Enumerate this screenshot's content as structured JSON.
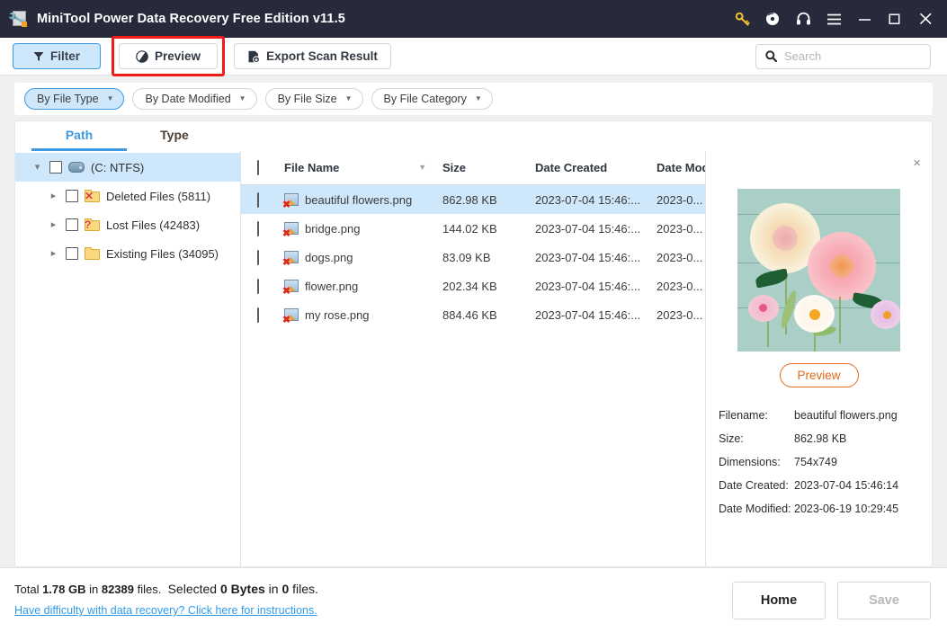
{
  "titlebar": {
    "app_icon": "wrench-document-icon",
    "title": "MiniTool Power Data Recovery Free Edition v11.5",
    "actions": [
      {
        "name": "key-icon",
        "glyph": "key",
        "color": "#f2c230"
      },
      {
        "name": "disc-icon",
        "glyph": "disc",
        "color": "#ffffff"
      },
      {
        "name": "headphones-icon",
        "glyph": "headphone",
        "color": "#ffffff"
      },
      {
        "name": "menu-icon",
        "glyph": "menu",
        "color": "#ffffff"
      },
      {
        "name": "minimize-icon",
        "glyph": "minimize",
        "color": "#ffffff"
      },
      {
        "name": "maximize-icon",
        "glyph": "maximize",
        "color": "#ffffff"
      },
      {
        "name": "close-icon",
        "glyph": "close",
        "color": "#ffffff"
      }
    ]
  },
  "toolbar": {
    "filter_label": "Filter",
    "preview_label": "Preview",
    "export_label": "Export Scan Result",
    "preview_highlight_color": "#ee1b18",
    "search": {
      "value": "",
      "placeholder": "Search"
    }
  },
  "filterbar": {
    "chips": [
      {
        "label": "By File Type",
        "active": true
      },
      {
        "label": "By Date Modified",
        "active": false
      },
      {
        "label": "By File Size",
        "active": false
      },
      {
        "label": "By File Category",
        "active": false
      }
    ]
  },
  "tabs": [
    {
      "label": "Path",
      "active": true
    },
    {
      "label": "Type",
      "active": false
    }
  ],
  "tree": {
    "root": {
      "label": "(C: NTFS)",
      "icon": "disk-icon",
      "selected": true,
      "expanded": true
    },
    "children": [
      {
        "label": "Deleted Files (5811)",
        "icon": "folder-deleted-icon",
        "badge": "x"
      },
      {
        "label": "Lost Files (42483)",
        "icon": "folder-lost-icon",
        "badge": "?"
      },
      {
        "label": "Existing Files (34095)",
        "icon": "folder-existing-icon",
        "badge": ""
      }
    ]
  },
  "filelist": {
    "columns": [
      "File Name",
      "Size",
      "Date Created",
      "Date Modifie"
    ],
    "sort_column": "File Name",
    "sort_direction": "desc",
    "rows": [
      {
        "name": "beautiful flowers.png",
        "size": "862.98 KB",
        "created": "2023-07-04 15:46:...",
        "modified": "2023-0...",
        "selected": true
      },
      {
        "name": "bridge.png",
        "size": "144.02 KB",
        "created": "2023-07-04 15:46:...",
        "modified": "2023-0...",
        "selected": false
      },
      {
        "name": "dogs.png",
        "size": "83.09 KB",
        "created": "2023-07-04 15:46:...",
        "modified": "2023-0...",
        "selected": false
      },
      {
        "name": "flower.png",
        "size": "202.34 KB",
        "created": "2023-07-04 15:46:...",
        "modified": "2023-0...",
        "selected": false
      },
      {
        "name": "my rose.png",
        "size": "884.46 KB",
        "created": "2023-07-04 15:46:...",
        "modified": "2023-0...",
        "selected": false
      }
    ]
  },
  "preview": {
    "close_glyph": "×",
    "image_alt": "beautiful flowers photo - paper flowers on mint wooden boards",
    "button_label": "Preview",
    "button_color": "#e06a1c",
    "details": [
      {
        "key": "Filename:",
        "value": "beautiful flowers.png"
      },
      {
        "key": "Size:",
        "value": "862.98 KB"
      },
      {
        "key": "Dimensions:",
        "value": "754x749"
      },
      {
        "key": "Date Created:",
        "value": "2023-07-04 15:46:14"
      },
      {
        "key": "Date Modified:",
        "value": "2023-06-19 10:29:45"
      }
    ]
  },
  "status": {
    "total_prefix": "Total ",
    "total_size": "1.78 GB",
    "total_mid": " in ",
    "total_count": "82389",
    "total_suffix": " files.",
    "selected_label": "Selected ",
    "selected_size": "0 Bytes",
    "selected_mid": " in ",
    "selected_count": "0",
    "selected_suffix": " files.",
    "help_link": "Have difficulty with data recovery? Click here for instructions.",
    "home_label": "Home",
    "save_label": "Save",
    "save_disabled": true
  }
}
